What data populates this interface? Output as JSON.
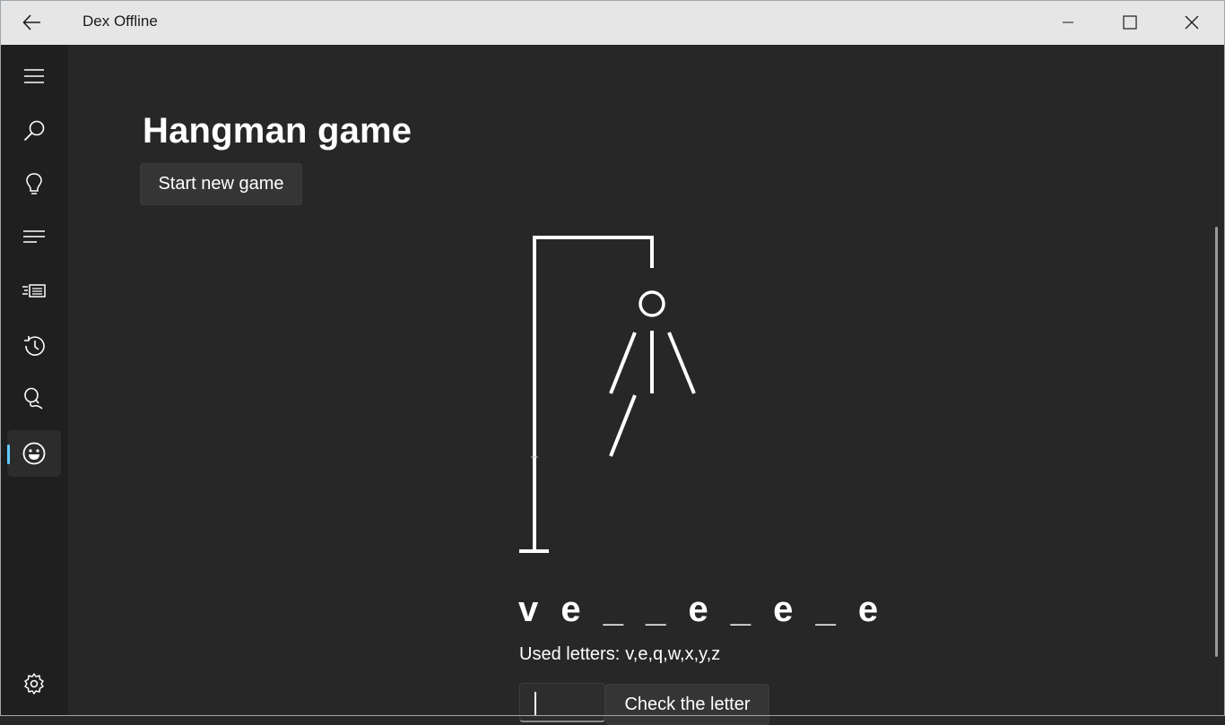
{
  "window": {
    "title": "Dex Offline"
  },
  "sidebar": {
    "items": [
      {
        "icon": "hamburger-menu-icon"
      },
      {
        "icon": "search-icon"
      },
      {
        "icon": "lightbulb-icon"
      },
      {
        "icon": "list-icon"
      },
      {
        "icon": "news-icon"
      },
      {
        "icon": "history-icon"
      },
      {
        "icon": "balloon-search-icon"
      },
      {
        "icon": "smiley-icon",
        "selected": true
      }
    ],
    "settings_icon": "gear-icon"
  },
  "page": {
    "title": "Hangman game",
    "start_button": "Start new game"
  },
  "game": {
    "word_pattern": "v e _ _ e _ e _ e",
    "used_label": "Used letters:",
    "used_letters": "v,e,q,w,x,y,z",
    "letter_input_value": "",
    "check_button": "Check the letter",
    "drawn_parts": [
      "head",
      "body",
      "left-arm",
      "right-arm",
      "left-leg"
    ]
  },
  "colors": {
    "background": "#272727",
    "sidebar": "#1f1f1f",
    "titlebar": "#e6e6e6",
    "accent": "#60cdff",
    "drawing": "#ffffff"
  }
}
